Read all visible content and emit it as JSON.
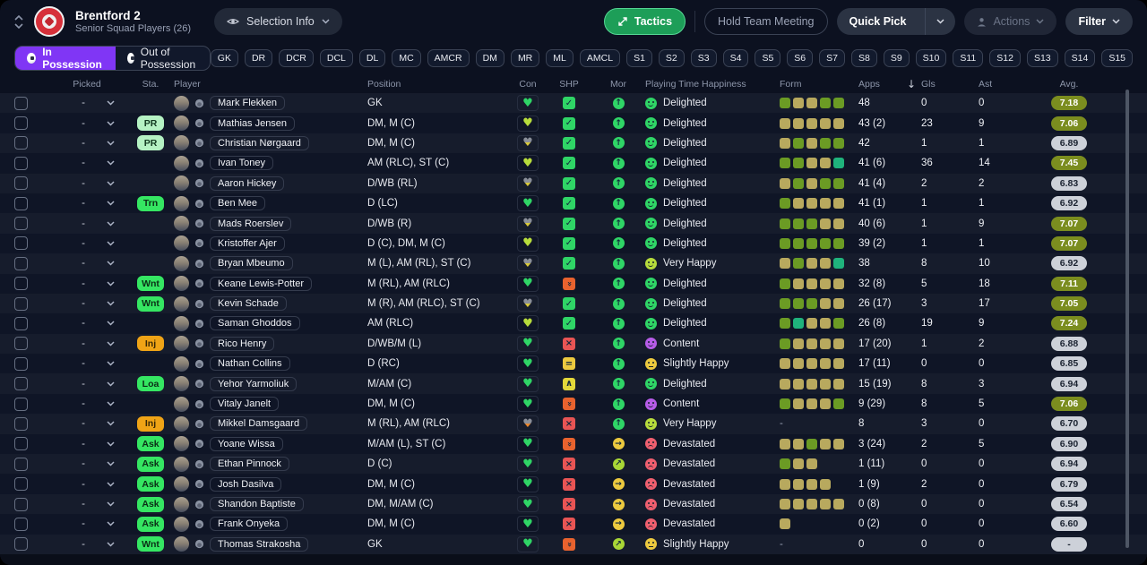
{
  "header": {
    "team_name": "Brentford 2",
    "team_subtitle": "Senior Squad Players (26)",
    "selection_info_label": "Selection Info",
    "tactics_label": "Tactics",
    "hold_team_meeting_label": "Hold Team Meeting",
    "quick_pick_label": "Quick Pick",
    "actions_label": "Actions",
    "filter_label": "Filter"
  },
  "possession_tabs": [
    {
      "label": "In Possession",
      "active": true
    },
    {
      "label": "Out of Possession",
      "active": false
    }
  ],
  "position_tabs": [
    "GK",
    "DR",
    "DCR",
    "DCL",
    "DL",
    "MC",
    "AMCR",
    "DM",
    "MR",
    "ML",
    "AMCL",
    "S1",
    "S2",
    "S3",
    "S4",
    "S5",
    "S6",
    "S7",
    "S8",
    "S9",
    "S10",
    "S11",
    "S12",
    "S13",
    "S14",
    "S15"
  ],
  "columns": {
    "picked": "Picked",
    "sta": "Sta.",
    "player": "Player",
    "position": "Position",
    "con": "Con",
    "shp": "SHP",
    "mor": "Mor",
    "happiness": "Playing Time Happiness",
    "form": "Form",
    "apps": "Apps",
    "gls": "Gls",
    "ast": "Ast",
    "avg": "Avg.",
    "sort_column": "Apps",
    "sort_direction": "desc"
  },
  "row_defaults": {
    "picked_value": "-"
  },
  "colors": {
    "accent_purple": "#8036f5",
    "tactics_green": "#1d9e58",
    "badge_pale_green": "#b5f2c3",
    "badge_green": "#35e662",
    "badge_orange": "#f0a416",
    "form_green": "#6b9b24",
    "form_khaki": "#b8a95e",
    "form_teal": "#1fb37c",
    "avg_olive": "#7b8d1f",
    "avg_gray": "#cdd1d9"
  },
  "sta_styles": {
    "pale": {
      "bg": "#b5f2c3",
      "fg": "#123a20"
    },
    "green": {
      "bg": "#35e662",
      "fg": "#0b2e16"
    },
    "orange": {
      "bg": "#f0a416",
      "fg": "#3a2a05"
    }
  },
  "moods": {
    "delighted": {
      "label": "Delighted",
      "color": "#2fd566",
      "mouth": "smile"
    },
    "very-happy": {
      "label": "Very Happy",
      "color": "#b7dc3c",
      "mouth": "smile"
    },
    "content": {
      "label": "Content",
      "color": "#b75ce8",
      "mouth": "smile"
    },
    "slightly-happy": {
      "label": "Slightly Happy",
      "color": "#ecc93f",
      "mouth": "neutral"
    },
    "devastated": {
      "label": "Devastated",
      "color": "#ef5f6f",
      "mouth": "frown"
    }
  },
  "shp_types": {
    "check": {
      "bg": "#2fd566",
      "glyph": "✓",
      "rot": false
    },
    "x": {
      "bg": "#e85454",
      "glyph": "×",
      "rot": false
    },
    "down2": {
      "bg": "#e8622e",
      "glyph": "»",
      "rot": true
    },
    "dash": {
      "bg": "#ecc93f",
      "glyph": "=",
      "rot": false
    },
    "up": {
      "bg": "#e3d83a",
      "glyph": "∧",
      "rot": false
    }
  },
  "mor_types": {
    "up-green": {
      "bg": "#2fd566",
      "glyph": "↑"
    },
    "right-yellow": {
      "bg": "#ecc93f",
      "glyph": "→"
    },
    "upright-yellowgreen": {
      "bg": "#a8d636",
      "glyph": "↗"
    }
  },
  "form_colors": {
    "g": "#6b9b24",
    "k": "#b8a95e",
    "t": "#1fb37c"
  },
  "avg_styles": {
    "olive": {
      "bg": "#7b8d1f",
      "fg": "#ffffff"
    },
    "gray": {
      "bg": "#cdd1d9",
      "fg": "#1a2230"
    }
  },
  "rows": [
    {
      "sta": null,
      "sta_style": null,
      "name": "Mark Flekken",
      "position": "GK",
      "con": "green",
      "shp": "check",
      "mor": "up-green",
      "mood": "delighted",
      "form": [
        "g",
        "k",
        "k",
        "g",
        "g"
      ],
      "apps": "48",
      "gls": "0",
      "ast": "0",
      "avg": "7.18",
      "avg_style": "olive"
    },
    {
      "sta": "PR",
      "sta_style": "pale",
      "name": "Mathias Jensen",
      "position": "DM, M (C)",
      "con": "yellowgreen",
      "shp": "check",
      "mor": "up-green",
      "mood": "delighted",
      "form": [
        "k",
        "k",
        "k",
        "k",
        "k"
      ],
      "apps": "43 (2)",
      "gls": "23",
      "ast": "9",
      "avg": "7.06",
      "avg_style": "olive"
    },
    {
      "sta": "PR",
      "sta_style": "pale",
      "name": "Christian Nørgaard",
      "position": "DM, M (C)",
      "con": "gray-yellow",
      "shp": "check",
      "mor": "up-green",
      "mood": "delighted",
      "form": [
        "k",
        "g",
        "k",
        "g",
        "g"
      ],
      "apps": "42",
      "gls": "1",
      "ast": "1",
      "avg": "6.89",
      "avg_style": "gray"
    },
    {
      "sta": null,
      "sta_style": null,
      "name": "Ivan Toney",
      "position": "AM (RLC), ST (C)",
      "con": "yellowgreen",
      "shp": "check",
      "mor": "up-green",
      "mood": "delighted",
      "form": [
        "g",
        "g",
        "k",
        "k",
        "t"
      ],
      "apps": "41 (6)",
      "gls": "36",
      "ast": "14",
      "avg": "7.45",
      "avg_style": "olive"
    },
    {
      "sta": null,
      "sta_style": null,
      "name": "Aaron Hickey",
      "position": "D/WB (RL)",
      "con": "gray-yellow",
      "shp": "check",
      "mor": "up-green",
      "mood": "delighted",
      "form": [
        "k",
        "g",
        "k",
        "g",
        "g"
      ],
      "apps": "41 (4)",
      "gls": "2",
      "ast": "2",
      "avg": "6.83",
      "avg_style": "gray"
    },
    {
      "sta": "Trn",
      "sta_style": "green",
      "name": "Ben Mee",
      "position": "D (LC)",
      "con": "green",
      "shp": "check",
      "mor": "up-green",
      "mood": "delighted",
      "form": [
        "g",
        "k",
        "k",
        "k",
        "k"
      ],
      "apps": "41 (1)",
      "gls": "1",
      "ast": "1",
      "avg": "6.92",
      "avg_style": "gray"
    },
    {
      "sta": null,
      "sta_style": null,
      "name": "Mads Roerslev",
      "position": "D/WB (R)",
      "con": "gray-yellow",
      "shp": "check",
      "mor": "up-green",
      "mood": "delighted",
      "form": [
        "g",
        "g",
        "g",
        "k",
        "k"
      ],
      "apps": "40 (6)",
      "gls": "1",
      "ast": "9",
      "avg": "7.07",
      "avg_style": "olive"
    },
    {
      "sta": null,
      "sta_style": null,
      "name": "Kristoffer Ajer",
      "position": "D (C), DM, M (C)",
      "con": "yellowgreen",
      "shp": "check",
      "mor": "up-green",
      "mood": "delighted",
      "form": [
        "g",
        "g",
        "g",
        "g",
        "g"
      ],
      "apps": "39 (2)",
      "gls": "1",
      "ast": "1",
      "avg": "7.07",
      "avg_style": "olive"
    },
    {
      "sta": null,
      "sta_style": null,
      "name": "Bryan Mbeumo",
      "position": "M (L), AM (RL), ST (C)",
      "con": "gray-yellow",
      "shp": "check",
      "mor": "up-green",
      "mood": "very-happy",
      "form": [
        "k",
        "g",
        "k",
        "k",
        "t"
      ],
      "apps": "38",
      "gls": "8",
      "ast": "10",
      "avg": "6.92",
      "avg_style": "gray"
    },
    {
      "sta": "Wnt",
      "sta_style": "green",
      "name": "Keane Lewis-Potter",
      "position": "M (RL), AM (RLC)",
      "con": "green",
      "shp": "down2",
      "mor": "up-green",
      "mood": "delighted",
      "form": [
        "g",
        "k",
        "k",
        "k",
        "k"
      ],
      "apps": "32 (8)",
      "gls": "5",
      "ast": "18",
      "avg": "7.11",
      "avg_style": "olive"
    },
    {
      "sta": "Wnt",
      "sta_style": "green",
      "name": "Kevin Schade",
      "position": "M (R), AM (RLC), ST (C)",
      "con": "gray-yellow",
      "shp": "check",
      "mor": "up-green",
      "mood": "delighted",
      "form": [
        "g",
        "g",
        "g",
        "k",
        "k"
      ],
      "apps": "26 (17)",
      "gls": "3",
      "ast": "17",
      "avg": "7.05",
      "avg_style": "olive"
    },
    {
      "sta": null,
      "sta_style": null,
      "name": "Saman Ghoddos",
      "position": "AM (RLC)",
      "con": "yellowgreen",
      "shp": "check",
      "mor": "up-green",
      "mood": "delighted",
      "form": [
        "g",
        "t",
        "k",
        "k",
        "g"
      ],
      "apps": "26 (8)",
      "gls": "19",
      "ast": "9",
      "avg": "7.24",
      "avg_style": "olive"
    },
    {
      "sta": "Inj",
      "sta_style": "orange",
      "name": "Rico Henry",
      "position": "D/WB/M (L)",
      "con": "green",
      "shp": "x",
      "mor": "up-green",
      "mood": "content",
      "form": [
        "g",
        "k",
        "k",
        "k",
        "k"
      ],
      "apps": "17 (20)",
      "gls": "1",
      "ast": "2",
      "avg": "6.88",
      "avg_style": "gray"
    },
    {
      "sta": null,
      "sta_style": null,
      "name": "Nathan Collins",
      "position": "D (RC)",
      "con": "green",
      "shp": "dash",
      "mor": "up-green",
      "mood": "slightly-happy",
      "form": [
        "k",
        "k",
        "k",
        "k",
        "k"
      ],
      "apps": "17 (11)",
      "gls": "0",
      "ast": "0",
      "avg": "6.85",
      "avg_style": "gray"
    },
    {
      "sta": "Loa",
      "sta_style": "green",
      "name": "Yehor Yarmoliuk",
      "position": "M/AM (C)",
      "con": "green",
      "shp": "up",
      "mor": "up-green",
      "mood": "delighted",
      "form": [
        "k",
        "k",
        "k",
        "k",
        "k"
      ],
      "apps": "15 (19)",
      "gls": "8",
      "ast": "3",
      "avg": "6.94",
      "avg_style": "gray"
    },
    {
      "sta": null,
      "sta_style": null,
      "name": "Vitaly Janelt",
      "position": "DM, M (C)",
      "con": "green",
      "shp": "down2",
      "mor": "up-green",
      "mood": "content",
      "form": [
        "g",
        "k",
        "k",
        "k",
        "g"
      ],
      "apps": "9 (29)",
      "gls": "8",
      "ast": "5",
      "avg": "7.06",
      "avg_style": "olive"
    },
    {
      "sta": "Inj",
      "sta_style": "orange",
      "name": "Mikkel Damsgaard",
      "position": "M (RL), AM (RLC)",
      "con": "gray-orange",
      "shp": "x",
      "mor": "up-green",
      "mood": "very-happy",
      "form": [],
      "apps": "8",
      "gls": "3",
      "ast": "0",
      "avg": "6.70",
      "avg_style": "gray"
    },
    {
      "sta": "Ask",
      "sta_style": "green",
      "name": "Yoane Wissa",
      "position": "M/AM (L), ST (C)",
      "con": "green",
      "shp": "down2",
      "mor": "right-yellow",
      "mood": "devastated",
      "form": [
        "k",
        "k",
        "g",
        "k",
        "k"
      ],
      "apps": "3 (24)",
      "gls": "2",
      "ast": "5",
      "avg": "6.90",
      "avg_style": "gray"
    },
    {
      "sta": "Ask",
      "sta_style": "green",
      "name": "Ethan Pinnock",
      "position": "D (C)",
      "con": "green",
      "shp": "x",
      "mor": "upright-yellowgreen",
      "mood": "devastated",
      "form": [
        "g",
        "k",
        "k"
      ],
      "apps": "1 (11)",
      "gls": "0",
      "ast": "0",
      "avg": "6.94",
      "avg_style": "gray"
    },
    {
      "sta": "Ask",
      "sta_style": "green",
      "name": "Josh Dasilva",
      "position": "DM, M (C)",
      "con": "green",
      "shp": "x",
      "mor": "right-yellow",
      "mood": "devastated",
      "form": [
        "k",
        "k",
        "k",
        "k"
      ],
      "apps": "1 (9)",
      "gls": "2",
      "ast": "0",
      "avg": "6.79",
      "avg_style": "gray"
    },
    {
      "sta": "Ask",
      "sta_style": "green",
      "name": "Shandon Baptiste",
      "position": "DM, M/AM (C)",
      "con": "green",
      "shp": "x",
      "mor": "right-yellow",
      "mood": "devastated",
      "form": [
        "k",
        "k",
        "k",
        "k",
        "k"
      ],
      "apps": "0 (8)",
      "gls": "0",
      "ast": "0",
      "avg": "6.54",
      "avg_style": "gray"
    },
    {
      "sta": "Ask",
      "sta_style": "green",
      "name": "Frank Onyeka",
      "position": "DM, M (C)",
      "con": "green",
      "shp": "x",
      "mor": "right-yellow",
      "mood": "devastated",
      "form": [
        "k"
      ],
      "apps": "0 (2)",
      "gls": "0",
      "ast": "0",
      "avg": "6.60",
      "avg_style": "gray"
    },
    {
      "sta": "Wnt",
      "sta_style": "green",
      "name": "Thomas Strakosha",
      "position": "GK",
      "con": "green",
      "shp": "down2",
      "mor": "upright-yellowgreen",
      "mood": "slightly-happy",
      "form": [],
      "apps": "0",
      "gls": "0",
      "ast": "0",
      "avg": "-",
      "avg_style": "gray"
    }
  ]
}
